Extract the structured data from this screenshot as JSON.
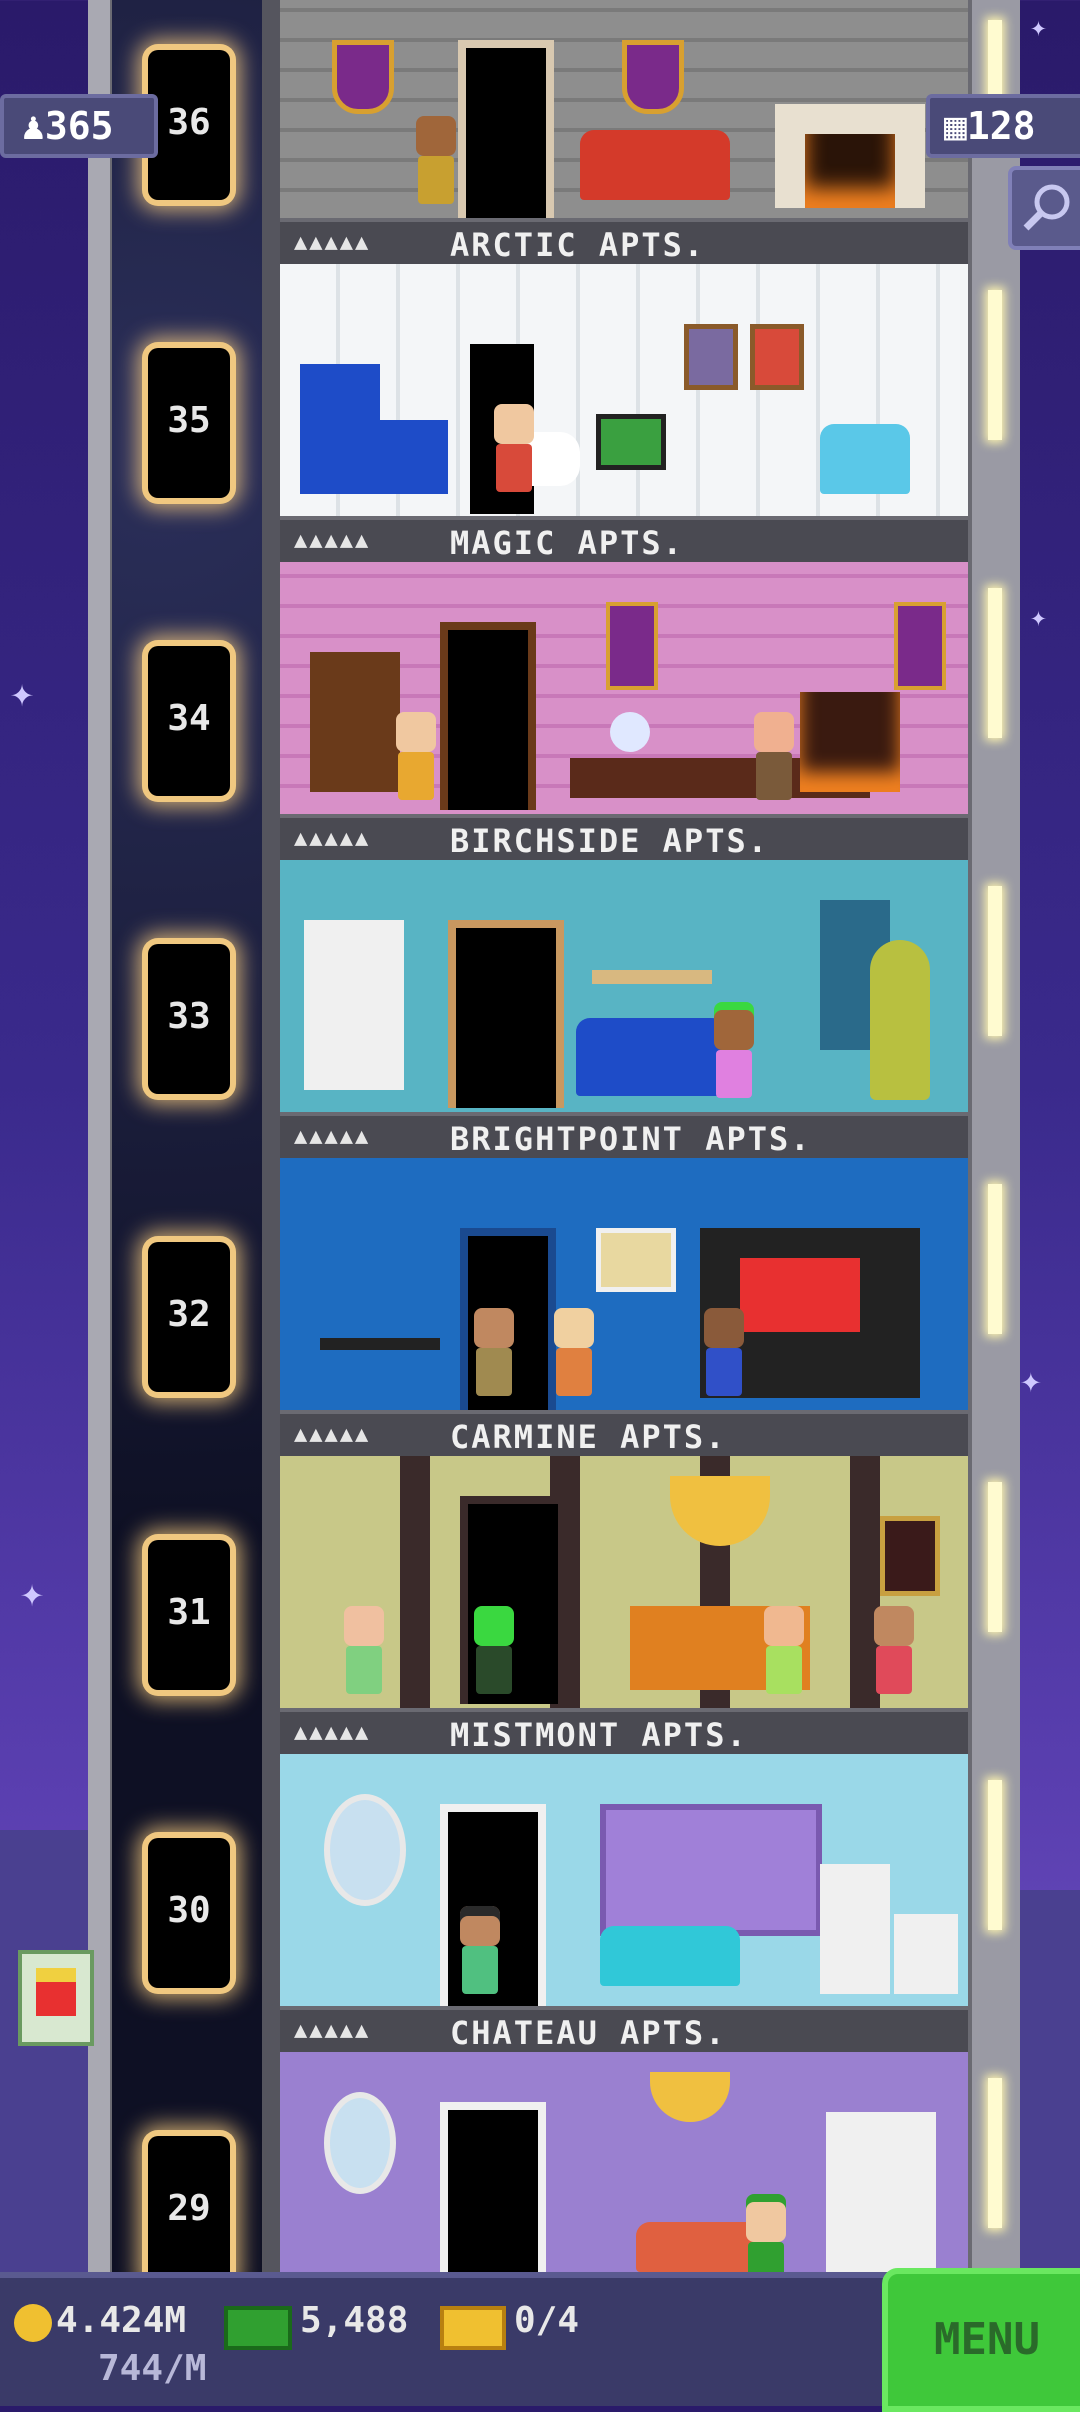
{
  "hud": {
    "population": "365",
    "population_icon": "person-icon",
    "floors": "128",
    "floors_icon": "building-icon",
    "search_icon": "magnifier-icon"
  },
  "floors": [
    {
      "number": "36",
      "label": "ARCTIC APTS.",
      "people": "▲▲▲▲▲",
      "wall": "#8e8e8e",
      "accent": "#d43a2a"
    },
    {
      "number": "35",
      "label": "MAGIC APTS.",
      "people": "▲▲▲▲▲",
      "wall": "#f2f4f6",
      "accent": "#1e4cc8"
    },
    {
      "number": "34",
      "label": "BIRCHSIDE APTS.",
      "people": "▲▲▲▲▲",
      "wall": "#d890c8",
      "accent": "#5a2a1a"
    },
    {
      "number": "33",
      "label": "BRIGHTPOINT APTS.",
      "people": "▲▲▲▲▲",
      "wall": "#58b4c4",
      "accent": "#1e4cc8"
    },
    {
      "number": "32",
      "label": "CARMINE APTS.",
      "people": "▲▲▲▲▲",
      "wall": "#1e6cc0",
      "accent": "#d43a2a"
    },
    {
      "number": "31",
      "label": "MISTMONT APTS.",
      "people": "▲▲▲▲▲",
      "wall": "#c8c888",
      "accent": "#f0a030"
    },
    {
      "number": "30",
      "label": "CHATEAU APTS.",
      "people": "▲▲▲▲▲",
      "wall": "#9ad8e8",
      "accent": "#30c8d8"
    },
    {
      "number": "29",
      "label": "",
      "people": "",
      "wall": "#9a80d0",
      "accent": "#e06040"
    }
  ],
  "bottom": {
    "coins": "4.424M",
    "coin_icon": "coin-icon",
    "coin_rate": "744/M",
    "bux": "5,488",
    "bux_icon": "cash-icon",
    "tickets": "0/4",
    "ticket_icon": "ticket-icon",
    "menu_label": "MENU"
  }
}
